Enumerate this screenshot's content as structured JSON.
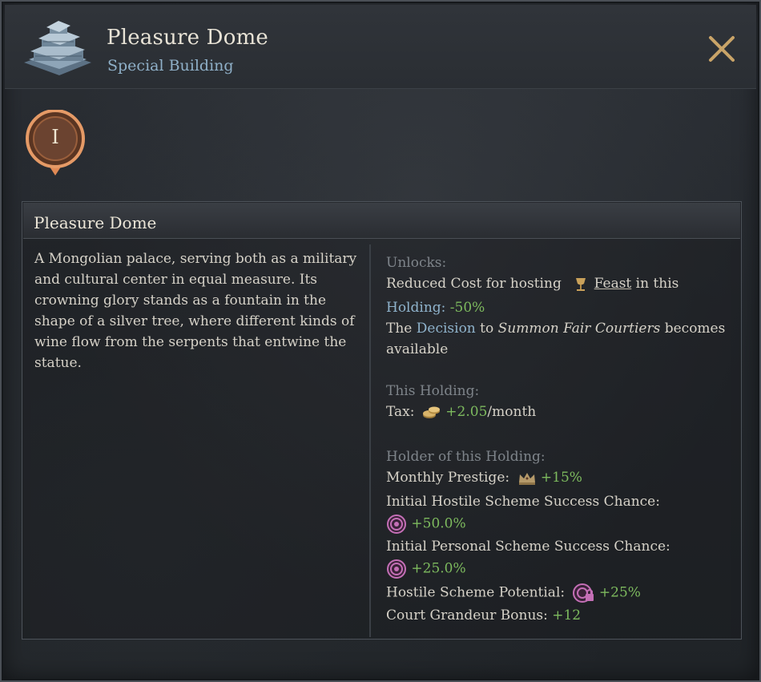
{
  "header": {
    "title": "Pleasure Dome",
    "subtitle": "Special Building"
  },
  "level_badge": {
    "numeral": "I"
  },
  "panel": {
    "title": "Pleasure Dome",
    "description": "A Mongolian palace, serving both as a military and cultural center in equal measure. Its crowning glory stands as a fountain in the shape of a silver tree, where different kinds of wine flow from the serpents that entwine the statue."
  },
  "unlocks": {
    "heading": "Unlocks:",
    "line1_prefix": "Reduced Cost for hosting",
    "line1_icon": "feast-goblet-icon",
    "line1_link": "Feast",
    "line1_suffix": "in this",
    "line2_label": "Holding:",
    "line2_value": "-50%",
    "line3_prefix": "The",
    "line3_decision": "Decision",
    "line3_to": "to",
    "line3_name": "Summon Fair Courtiers",
    "line3_suffix": "becomes",
    "line4": "available"
  },
  "this_holding": {
    "heading": "This Holding:",
    "tax_label": "Tax:",
    "tax_icon": "gold-coins-icon",
    "tax_value": "+2.05",
    "tax_unit": "/month"
  },
  "holder": {
    "heading": "Holder of this Holding:",
    "prestige_label": "Monthly Prestige:",
    "prestige_icon": "crown-icon",
    "prestige_value": "+15%",
    "hostile_label": "Initial Hostile Scheme Success Chance:",
    "hostile_icon": "scheme-target-icon",
    "hostile_value": "+50.0%",
    "personal_label": "Initial Personal Scheme Success Chance:",
    "personal_icon": "scheme-target-icon",
    "personal_value": "+25.0%",
    "potential_label": "Hostile Scheme Potential:",
    "potential_icon": "scheme-lock-icon",
    "potential_value": "+25%",
    "grandeur_label": "Court Grandeur Bonus:",
    "grandeur_value": "+12"
  },
  "colors": {
    "positive": "#7dba5e",
    "accent_blue": "#8fb3cc",
    "badge_orange": "#e08a55",
    "close_gold": "#c9a468"
  }
}
